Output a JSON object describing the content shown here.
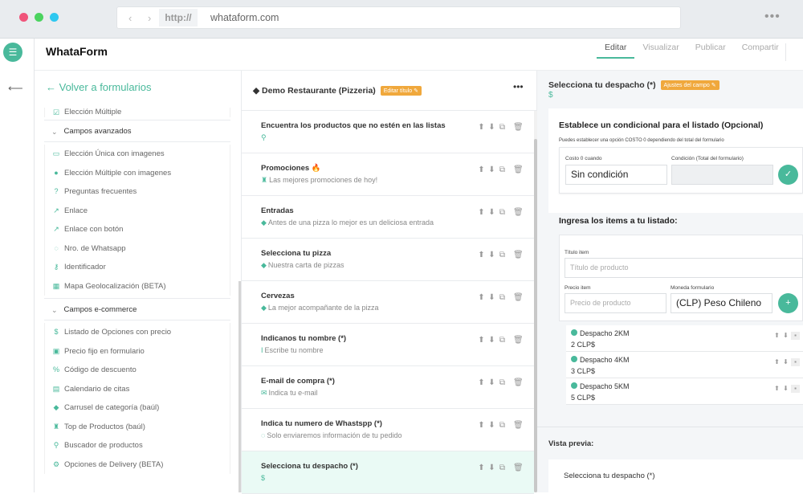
{
  "browser": {
    "url_protocol": "http://",
    "url_host": "whataform.com",
    "nav_arrows": "‹ ›",
    "more": "•••",
    "dot_colors": [
      "#f0547a",
      "#4bd35f",
      "#2ec8f0"
    ]
  },
  "app": {
    "brand": "WhataForm",
    "accent": "#49b99b",
    "badge_color": "#f0a83c"
  },
  "topnav": {
    "items": [
      "Editar",
      "Visualizar",
      "Publicar",
      "Compartir"
    ],
    "active": "Editar"
  },
  "left": {
    "back_label": "← Volver a formularios",
    "partial_item": {
      "label": "Elección Múltiple",
      "icon": "check-square-icon"
    },
    "sections": [
      {
        "label": "Campos avanzados",
        "items": [
          {
            "label": "Elección Única con imagenes",
            "icon": "image-icon"
          },
          {
            "label": "Elección Múltiple con imagenes",
            "icon": "check-circle-icon"
          },
          {
            "label": "Preguntas frecuentes",
            "icon": "question-icon"
          },
          {
            "label": "Enlace",
            "icon": "external-link-icon"
          },
          {
            "label": "Enlace con botón",
            "icon": "external-link-icon"
          },
          {
            "label": "Nro. de Whatsapp",
            "icon": "whatsapp-icon"
          },
          {
            "label": "Identificador",
            "icon": "key-icon"
          },
          {
            "label": "Mapa Geolocalización (BETA)",
            "icon": "map-icon"
          }
        ]
      },
      {
        "label": "Campos e-commerce",
        "items": [
          {
            "label": "Listado de Opciones con precio",
            "icon": "dollar-icon"
          },
          {
            "label": "Precio fijo en formulario",
            "icon": "money-icon"
          },
          {
            "label": "Código de descuento",
            "icon": "percent-icon"
          },
          {
            "label": "Calendario de citas",
            "icon": "calendar-icon"
          },
          {
            "label": "Carrusel de categoría (baúl)",
            "icon": "tag-icon"
          },
          {
            "label": "Top de Productos (baúl)",
            "icon": "trophy-icon"
          },
          {
            "label": "Buscador de productos",
            "icon": "search-icon"
          },
          {
            "label": "Opciones de Delivery (BETA)",
            "icon": "motorcycle-icon"
          }
        ]
      }
    ]
  },
  "middle": {
    "title": "Demo Restaurante (Pizzeria)",
    "edit_title_label": "Editar título",
    "more": "•••",
    "rows": [
      {
        "title": "Encuentra los productos que no estén en las listas",
        "sub": "",
        "icon": "search-icon",
        "glyph": "⚲"
      },
      {
        "title": "Promociones 🔥",
        "sub": "Las mejores promociones de hoy!",
        "icon": "trophy-icon",
        "glyph": "♜"
      },
      {
        "title": "Entradas",
        "sub": "Antes de una pizza lo mejor es un deliciosa entrada",
        "icon": "tag-icon",
        "glyph": "◆"
      },
      {
        "title": "Selecciona tu pizza",
        "sub": "Nuestra carta de pizzas",
        "icon": "tag-icon",
        "glyph": "◆"
      },
      {
        "title": "Cervezas",
        "sub": "La mejor acompañante de la pizza",
        "icon": "tag-icon",
        "glyph": "◆"
      },
      {
        "title": "Indicanos tu nombre (*)",
        "sub": "Escribe tu nombre",
        "icon": "text-cursor-icon",
        "glyph": "I"
      },
      {
        "title": "E-mail de compra (*)",
        "sub": "Indica tu e-mail",
        "icon": "envelope-icon",
        "glyph": "✉"
      },
      {
        "title": "Indica tu numero de Whastspp (*)",
        "sub": "Solo enviaremos información de tu pedido",
        "icon": "whatsapp-icon",
        "glyph": "◌"
      },
      {
        "title": "Selecciona tu despacho (*)",
        "sub": "",
        "icon": "dollar-icon",
        "glyph": "$"
      }
    ]
  },
  "right": {
    "field_title": "Selecciona tu despacho (*)",
    "field_settings_label": "Ajustes del campo",
    "field_type_glyph": "$",
    "conditional": {
      "title": "Establece un condicional para el listado (Opcional)",
      "hint": "Puedes establecer una opción COSTO 0 dependiendo del total del formulario",
      "cost_label": "Costo 0 cuando",
      "cost_value": "Sin condición",
      "condition_label": "Condición (Total del formulario)",
      "condition_value": ""
    },
    "items_form": {
      "title": "Ingresa los items a tu listado:",
      "item_title_label": "Título item",
      "item_title_placeholder": "Título de producto",
      "price_label": "Precio item",
      "price_placeholder": "Precio de producto",
      "currency_label": "Moneda formulario",
      "currency_value": "(CLP) Peso Chileno"
    },
    "items": [
      {
        "name": "Despacho 2KM",
        "price": "2 CLP$"
      },
      {
        "name": "Despacho 4KM",
        "price": "3 CLP$"
      },
      {
        "name": "Despacho 5KM",
        "price": "5 CLP$"
      }
    ],
    "preview_label": "Vista previa:",
    "preview_title": "Selecciona tu despacho (*)"
  }
}
